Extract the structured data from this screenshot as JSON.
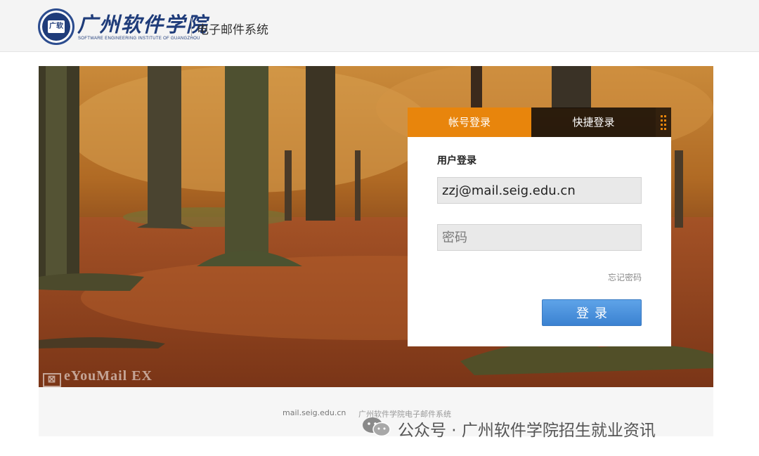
{
  "header": {
    "logo_seal_text": "广软",
    "logo_cn": "广州软件学院",
    "logo_en": "SOFTWARE ENGINEERING INSTITUTE OF GUANGZHOU",
    "system_name": "电子邮件系统"
  },
  "banner": {
    "watermark": "eYouMail EX",
    "watermark_mark": "⊠"
  },
  "login": {
    "tabs": [
      {
        "label": "帐号登录",
        "active": true
      },
      {
        "label": "快捷登录",
        "active": false
      }
    ],
    "title": "用户登录",
    "username_value": "zzj@mail.seig.edu.cn",
    "password_placeholder": "密码",
    "forgot_label": "忘记密码",
    "submit_label": "登录"
  },
  "footer": {
    "domain": "mail.seig.edu.cn",
    "name": "广州软件学院电子邮件系统"
  },
  "overlay": {
    "wechat_text": "公众号 · 广州软件学院招生就业资讯",
    "icon": "wechat-icon"
  },
  "colors": {
    "accent_orange": "#e8850c",
    "button_blue": "#3b82d1",
    "brand_navy": "#1f3c7a"
  }
}
